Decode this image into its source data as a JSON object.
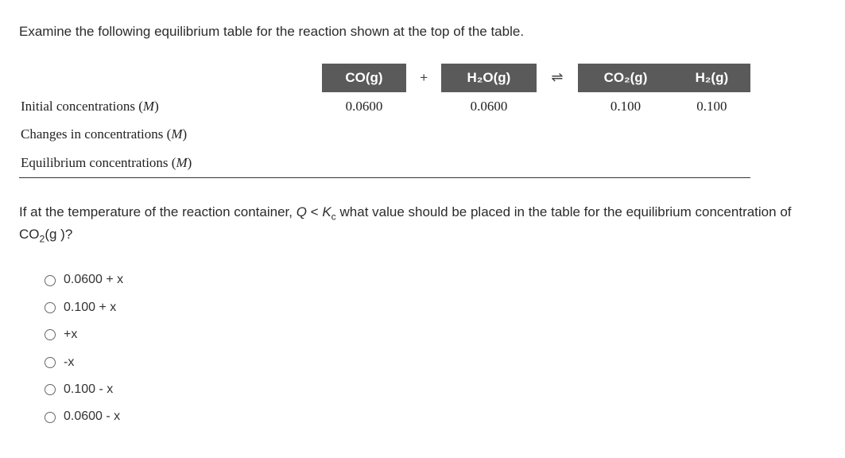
{
  "prompt": "Examine the following equilibrium table for the reaction shown at the top of the table.",
  "table": {
    "header": {
      "col_label_blank": "",
      "species1": "CO(g)",
      "plus": "+",
      "species2": "H₂O(g)",
      "arrow": "⇌",
      "species3": "CO₂(g)",
      "species4": "H₂(g)"
    },
    "rows": [
      {
        "label": "Initial concentrations (M)",
        "v1": "0.0600",
        "v2": "0.0600",
        "v3": "0.100",
        "v4": "0.100"
      },
      {
        "label": "Changes in concentrations (M)",
        "v1": "",
        "v2": "",
        "v3": "",
        "v4": ""
      },
      {
        "label": "Equilibrium concentrations (M)",
        "v1": "",
        "v2": "",
        "v3": "",
        "v4": ""
      }
    ]
  },
  "question": "If at the temperature of the reaction container, Q < Kc what value should be placed in the table for the equilibrium concentration of CO₂(g )?",
  "options": [
    {
      "label": "0.0600 + x"
    },
    {
      "label": "0.100 + x"
    },
    {
      "label": "+x"
    },
    {
      "label": "-x"
    },
    {
      "label": "0.100 - x"
    },
    {
      "label": "0.0600 - x"
    }
  ]
}
